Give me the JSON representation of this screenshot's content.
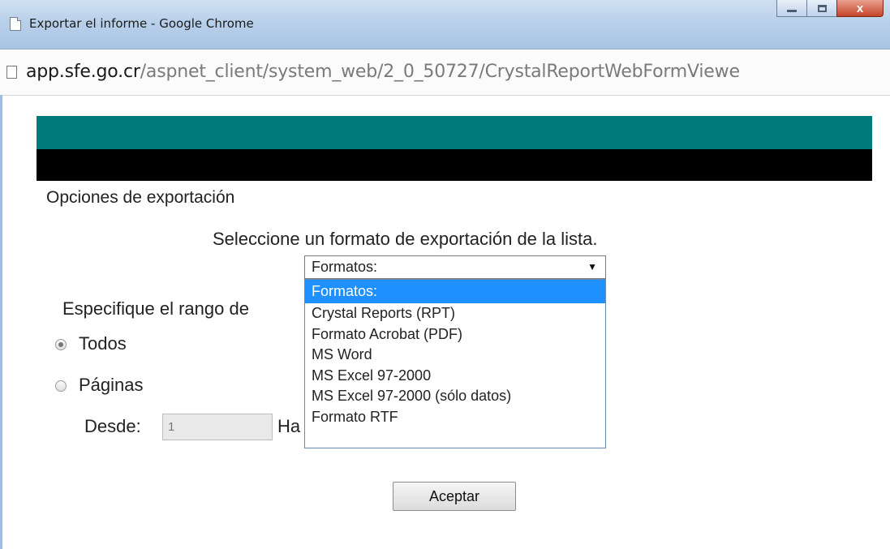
{
  "window": {
    "title": "Exportar el informe - Google Chrome",
    "close_glyph": "x"
  },
  "address": {
    "host": "app.sfe.go.cr",
    "path": "/aspnet_client/system_web/2_0_50727/CrystalReportWebFormViewe"
  },
  "export": {
    "section_title": "Opciones de exportación",
    "select_prompt": "Seleccione un formato de exportación de la lista.",
    "select_value": "Formatos:",
    "options": [
      "Formatos:",
      "Crystal Reports (RPT)",
      "Formato Acrobat (PDF)",
      "MS Word",
      "MS Excel 97-2000",
      "MS Excel 97-2000 (sólo datos)",
      "Formato RTF"
    ]
  },
  "range": {
    "label": "Especifique el rango de",
    "all_label": "Todos",
    "pages_label": "Páginas",
    "from_label": "Desde:",
    "from_value": "1",
    "to_label": "Ha"
  },
  "buttons": {
    "accept": "Aceptar"
  },
  "colors": {
    "header_band": "#007b7b",
    "dropdown_highlight": "#1e90ff"
  }
}
